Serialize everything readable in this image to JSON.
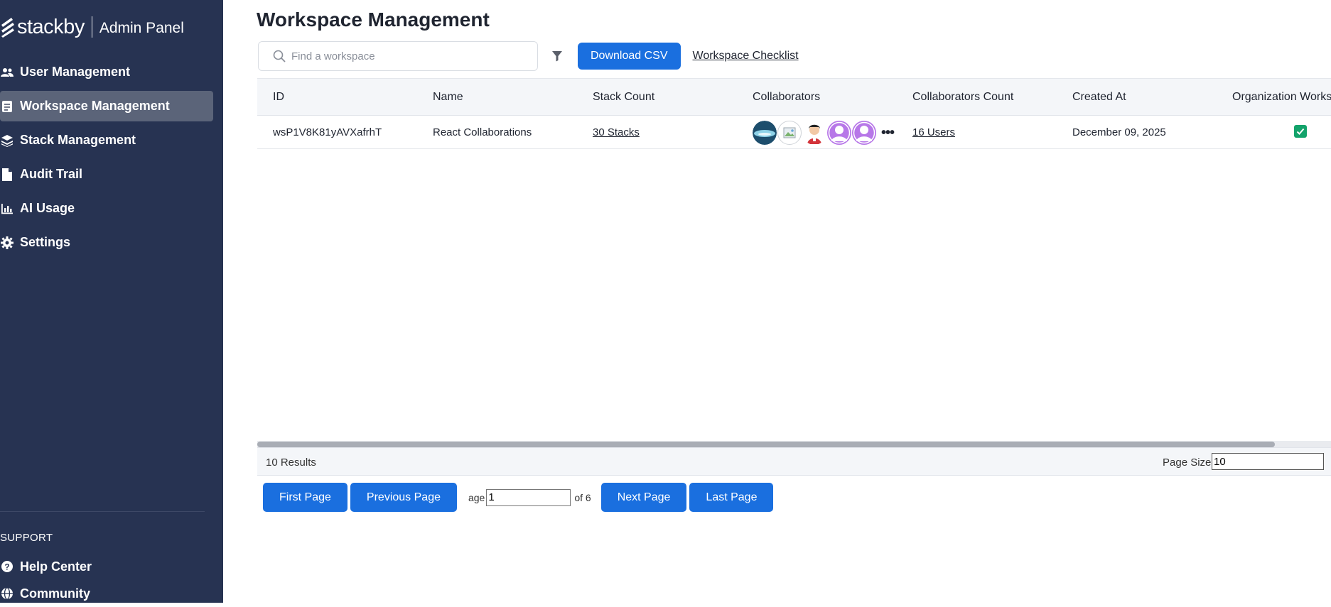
{
  "brand": {
    "name": "stackby",
    "subtitle": "Admin Panel"
  },
  "sidebar": {
    "items": [
      {
        "label": "User Management",
        "icon": "users-icon"
      },
      {
        "label": "Workspace Management",
        "icon": "workspace-icon",
        "active": true
      },
      {
        "label": "Stack Management",
        "icon": "stack-icon"
      },
      {
        "label": "Audit Trail",
        "icon": "document-icon"
      },
      {
        "label": "AI Usage",
        "icon": "bar-chart-icon"
      },
      {
        "label": "Settings",
        "icon": "gear-icon"
      }
    ],
    "support_heading": "SUPPORT",
    "support_items": [
      {
        "label": "Help Center",
        "icon": "help-circle-icon"
      },
      {
        "label": "Community",
        "icon": "globe-icon"
      }
    ]
  },
  "main": {
    "title": "Workspace Management",
    "search": {
      "placeholder": "Find a workspace",
      "value": ""
    },
    "download_csv_label": "Download CSV",
    "checklist_label": "Workspace Checklist"
  },
  "table": {
    "columns": [
      "ID",
      "Name",
      "Stack Count",
      "Collaborators",
      "Collaborators Count",
      "Created At",
      "Organization Works"
    ],
    "rows": [
      {
        "id": "wsP1V8K81yAVXafrhT",
        "name": "React Collaborations",
        "stack_count": "30 Stacks",
        "collaborators_count": "16 Users",
        "created_at": "December 09, 2025",
        "organization": true
      }
    ],
    "results": "10 Results",
    "page_size_label": "Page Size:",
    "page_size": "10"
  },
  "pager": {
    "first": "First Page",
    "previous": "Previous Page",
    "page_label": "age",
    "page_value": "1",
    "of_label": "of 6",
    "next": "Next Page",
    "last": "Last Page"
  },
  "colors": {
    "sidebar_bg": "#273352",
    "active_item_bg": "#5b6479",
    "primary_button": "#1a6fdf",
    "check_green": "#13a36b",
    "avatar_purple": "#b777e8"
  }
}
